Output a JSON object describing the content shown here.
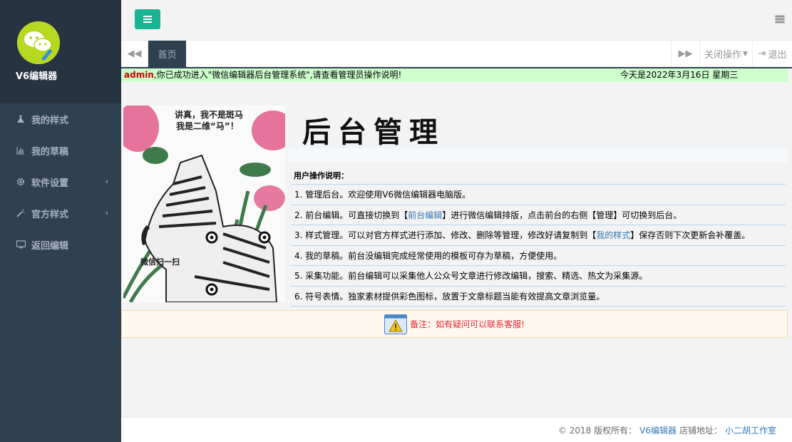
{
  "sidebar": {
    "brand": "V6编辑器",
    "items": [
      {
        "label": "我的样式",
        "icon": "flask-icon",
        "has_arrow": false
      },
      {
        "label": "我的草稿",
        "icon": "bar-chart-icon",
        "has_arrow": false
      },
      {
        "label": "软件设置",
        "icon": "gear-icon",
        "has_arrow": true
      },
      {
        "label": "官方样式",
        "icon": "magic-wand-icon",
        "has_arrow": true
      },
      {
        "label": "返回编辑",
        "icon": "monitor-icon",
        "has_arrow": false
      }
    ]
  },
  "tabs": {
    "home": "首页",
    "close_ops": "关闭操作",
    "logout": "退出"
  },
  "welcome": {
    "user": "admin",
    "message": ",你已成功进入\"微信编辑器后台管理系统\",请查看管理员操作说明!",
    "date": "今天是2022年3月16日   星期三"
  },
  "poster": {
    "line1": "讲真，我不是斑马",
    "line2": "我是二维“马”！",
    "caption": "微信扫一扫"
  },
  "main": {
    "title": "后台管理",
    "guide_header": "用户操作说明：",
    "rows": [
      {
        "pre": "1. 管理后台。欢迎使用V6微信编辑器电脑版。",
        "link": "",
        "post": ""
      },
      {
        "pre": "2. 前台编辑。可直接切换到【",
        "link": "前台编辑",
        "post": "】进行微信编辑排版，点击前台的右侧【管理】可切换到后台。"
      },
      {
        "pre": "3. 样式管理。可以对官方样式进行添加、修改、删除等管理，修改好请复制到【",
        "link": "我的样式",
        "post": "】保存否则下次更新会补覆盖。"
      },
      {
        "pre": "4. 我的草稿。前台没编辑完成经常使用的模板可存为草稿，方便使用。",
        "link": "",
        "post": ""
      },
      {
        "pre": "5. 采集功能。前台编辑可以采集他人公众号文章进行修改编辑，搜索、精选、热文为采集源。",
        "link": "",
        "post": ""
      },
      {
        "pre": "6. 符号表情。独家素材提供彩色图标，放置于文章标题当能有效提高文章浏览量。",
        "link": "",
        "post": ""
      }
    ],
    "note": "备注：如有疑问可以联系客服!"
  },
  "footer": {
    "copyright": "© 2018 版权所有：",
    "brand_link": "V6编辑器",
    "shop_label": "店铺地址：",
    "shop_link": "小二胡工作室"
  },
  "colors": {
    "sidebar_bg": "#2f4050",
    "accent": "#1ab394",
    "welcome_bg": "#ccffcc",
    "link": "#337ab7"
  }
}
